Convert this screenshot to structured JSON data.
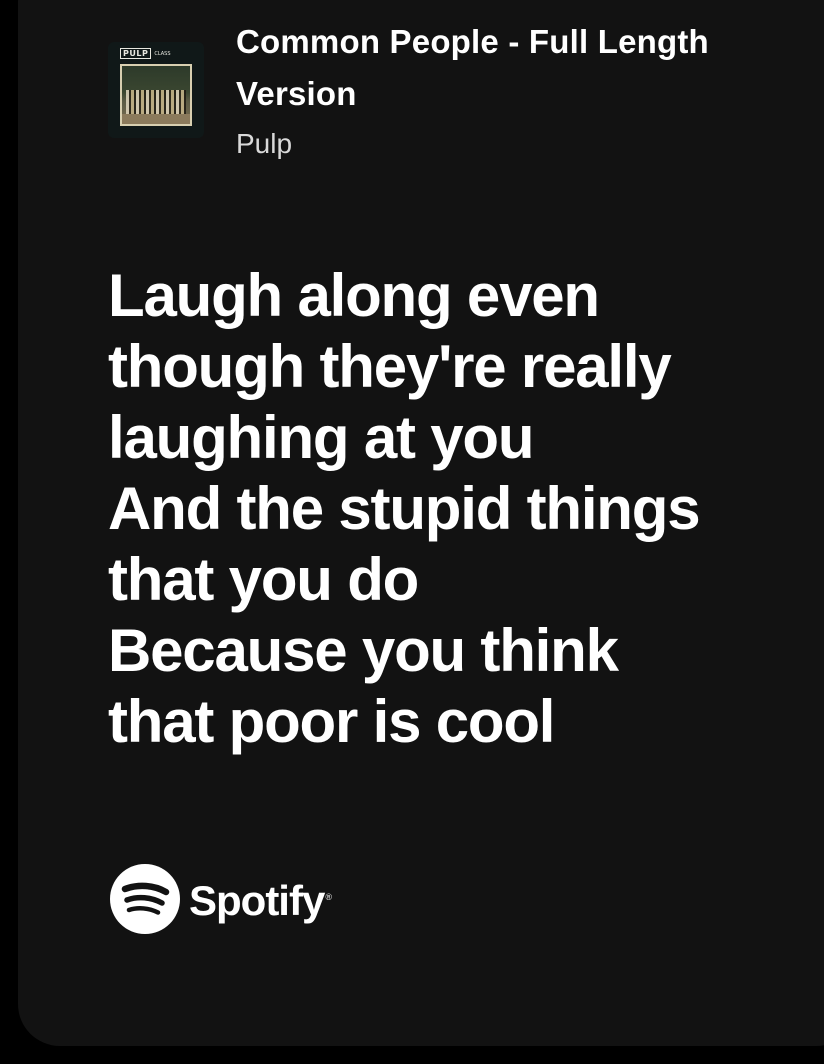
{
  "track": {
    "title": "Common People - Full Length Version",
    "artist": "Pulp"
  },
  "album_art": {
    "logo_text": "PULP",
    "logo_subtext": "CLASS"
  },
  "lyrics": {
    "lines": [
      "Laugh along even",
      "though they're really",
      "laughing at you",
      "And the stupid things",
      "that you do",
      "Because you think",
      "that poor is cool"
    ]
  },
  "footer": {
    "brand": "Spotify",
    "brand_mark": "®",
    "icon": "spotify-logo-icon"
  },
  "colors": {
    "page_background": "#000000",
    "card_background": "#121212",
    "text": "#ffffff",
    "subtext": "#d9d9d9"
  }
}
